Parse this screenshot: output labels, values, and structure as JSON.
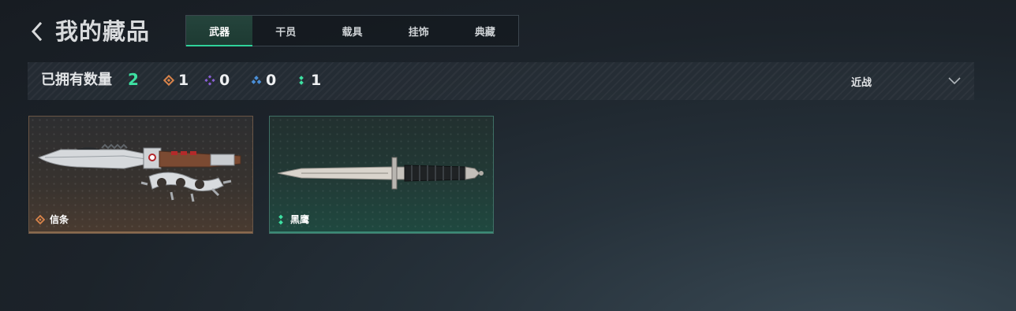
{
  "header": {
    "back_icon": "chevron-left-icon",
    "title": "我的藏品"
  },
  "tabs": [
    {
      "label": "武器",
      "active": true
    },
    {
      "label": "干员",
      "active": false
    },
    {
      "label": "载具",
      "active": false
    },
    {
      "label": "挂饰",
      "active": false
    },
    {
      "label": "典藏",
      "active": false
    }
  ],
  "stats": {
    "owned_label": "已拥有数量",
    "owned_count": "2",
    "rarities": [
      {
        "icon": "orange-diamond-icon",
        "color": "#d8834a",
        "count": "1"
      },
      {
        "icon": "purple-diamond-icon",
        "color": "#8b5fd6",
        "count": "0"
      },
      {
        "icon": "blue-triangle-icon",
        "color": "#4a8fd8",
        "count": "0"
      },
      {
        "icon": "green-dots-icon",
        "color": "#3ee0a2",
        "count": "1"
      }
    ]
  },
  "filter": {
    "value": "近战",
    "icon": "chevron-down-icon"
  },
  "items": [
    {
      "name": "信条",
      "rarity": "orange",
      "rarity_icon": "orange-diamond-icon",
      "weapon_icon": "knuckle-knife-icon"
    },
    {
      "name": "黑鹰",
      "rarity": "green",
      "rarity_icon": "green-dots-icon",
      "weapon_icon": "combat-knife-icon"
    }
  ],
  "colors": {
    "accent": "#2fd29a",
    "count_green": "#3ee0a2",
    "orange": "#d8834a",
    "purple": "#8b5fd6",
    "blue": "#4a8fd8"
  }
}
